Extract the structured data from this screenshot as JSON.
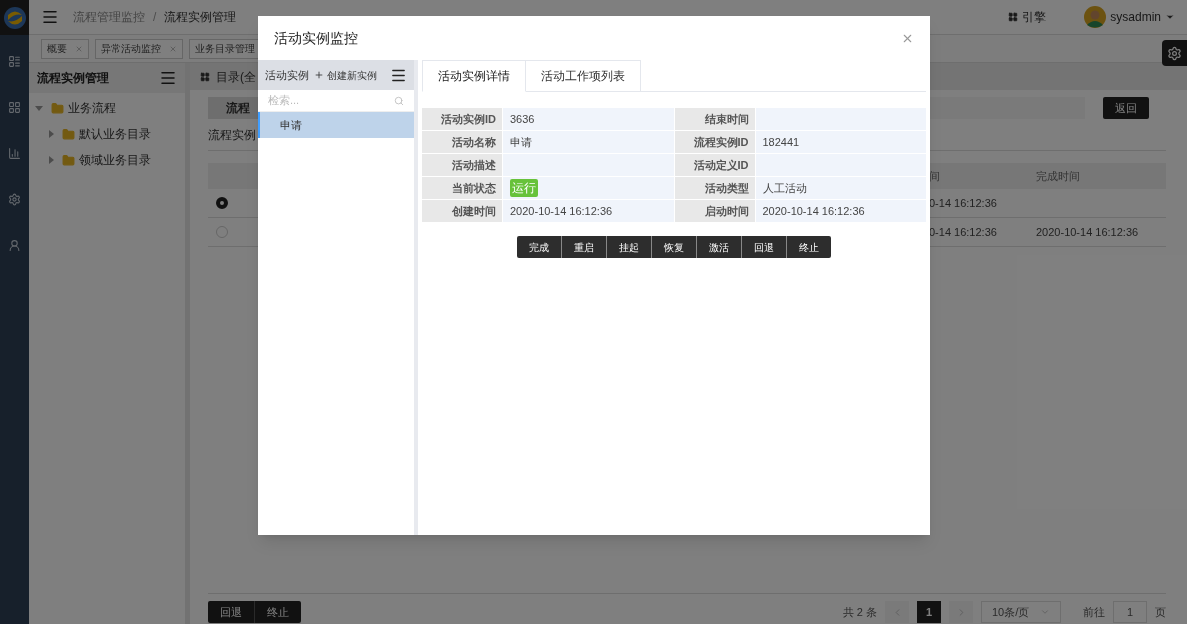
{
  "header": {
    "breadcrumb": [
      "流程管理监控",
      "流程实例管理"
    ],
    "breadcrumb_separator": "/",
    "engine": "引擎",
    "user": "sysadmin"
  },
  "nav_tabs": [
    {
      "label": "概要",
      "closable": true
    },
    {
      "label": "异常活动监控",
      "closable": true
    },
    {
      "label": "业务目录管理",
      "closable": false
    }
  ],
  "left_panel": {
    "title": "流程实例管理",
    "tree": [
      {
        "label": "业务流程",
        "expanded": true,
        "children": [
          {
            "label": "默认业务目录",
            "expanded": false
          },
          {
            "label": "领域业务目录",
            "expanded": false
          }
        ]
      }
    ]
  },
  "main": {
    "catalog": "目录(全",
    "filter_tab": "流程",
    "back_button": "返回",
    "section_title": "流程实例",
    "table": {
      "columns": [
        "间",
        "完成时间"
      ],
      "rows": [
        {
          "selected": true,
          "cells": [
            "0-14 16:12:36"
          ]
        },
        {
          "selected": false,
          "cells": [
            "0-14 16:12:36",
            "2020-10-14 16:12:36"
          ]
        }
      ]
    },
    "footer": {
      "buttons": [
        "回退",
        "终止"
      ],
      "total": "共 2 条",
      "pages": [
        {
          "label": "1",
          "selected": true
        }
      ],
      "page_size": "10条/页",
      "goto_label": "前往",
      "goto_value": "1",
      "goto_suffix": "页"
    }
  },
  "modal": {
    "title": "活动实例监控",
    "instances": {
      "title": "活动实例",
      "create": "创建新实例",
      "search_placeholder": "检索...",
      "items": [
        {
          "label": "申请",
          "selected": true
        }
      ]
    },
    "tabs": [
      {
        "label": "活动实例详情",
        "selected": true
      },
      {
        "label": "活动工作项列表",
        "selected": false
      }
    ],
    "details": [
      [
        {
          "label": "活动实例ID",
          "kind": "text",
          "value": "3636"
        },
        {
          "label": "结束时间",
          "kind": "text"
        }
      ],
      [
        {
          "label": "活动名称",
          "kind": "text",
          "value": "申请"
        },
        {
          "label": "流程实例ID",
          "kind": "text",
          "value": "182441"
        }
      ],
      [
        {
          "label": "活动描述",
          "kind": "text"
        },
        {
          "label": "活动定义ID",
          "kind": "text"
        }
      ],
      [
        {
          "label": "当前状态",
          "kind": "tag",
          "value": "运行"
        },
        {
          "label": "活动类型",
          "kind": "text",
          "value": "人工活动"
        }
      ],
      [
        {
          "label": "创建时间",
          "kind": "text",
          "value": "2020-10-14 16:12:36"
        },
        {
          "label": "启动时间",
          "kind": "text",
          "value": "2020-10-14 16:12:36"
        }
      ]
    ],
    "actions": [
      "完成",
      "重启",
      "挂起",
      "恢复",
      "激活",
      "回退",
      "终止"
    ]
  }
}
